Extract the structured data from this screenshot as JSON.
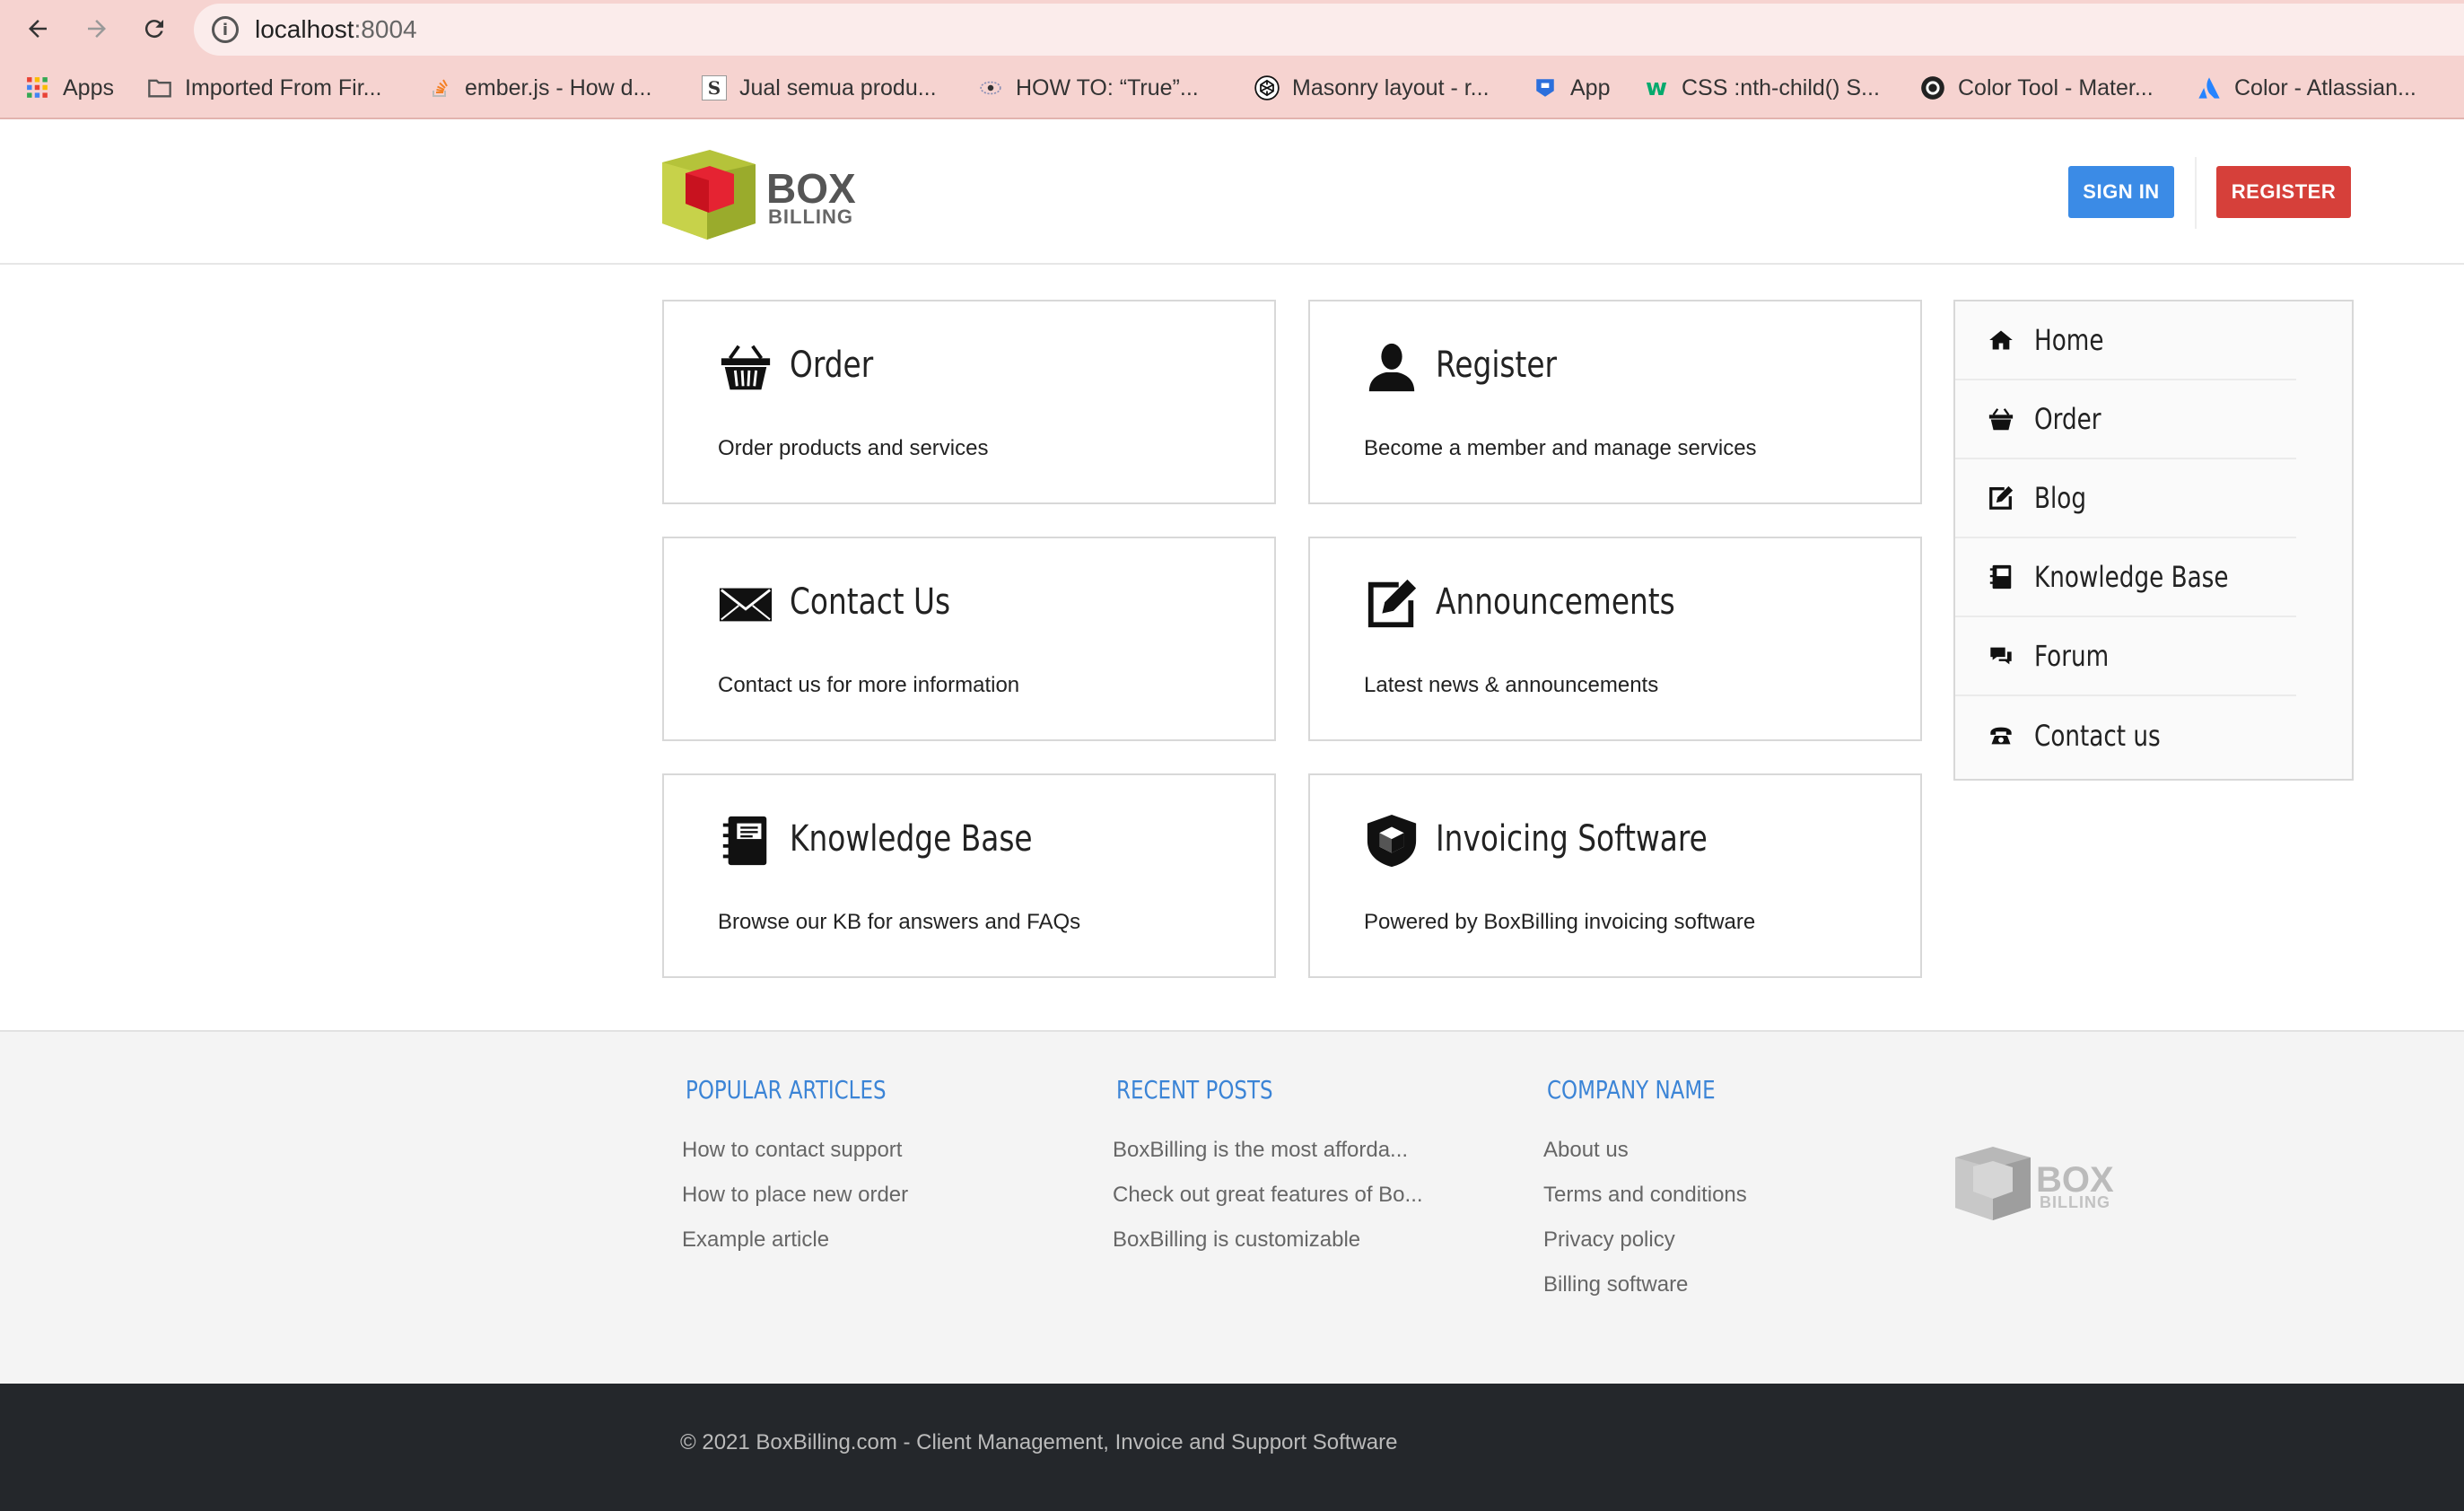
{
  "browser": {
    "url_host": "localhost",
    "url_port": ":8004",
    "bookmarks": [
      {
        "label": "Apps",
        "icon": "apps-grid-icon"
      },
      {
        "label": "Imported From Fir...",
        "icon": "folder-icon"
      },
      {
        "label": "ember.js - How d...",
        "icon": "stackoverflow-icon"
      },
      {
        "label": "Jual semua produ...",
        "icon": "s-icon",
        "glyph": "S"
      },
      {
        "label": "HOW TO: “True”...",
        "icon": "eye-icon"
      },
      {
        "label": "Masonry layout - r...",
        "icon": "codepen-icon"
      },
      {
        "label": "App",
        "icon": "app-icon"
      },
      {
        "label": "CSS :nth-child() S...",
        "icon": "w3schools-icon",
        "glyph": "w"
      },
      {
        "label": "Color Tool - Mater...",
        "icon": "github-icon"
      },
      {
        "label": "Color - Atlassian...",
        "icon": "atlassian-icon"
      }
    ]
  },
  "header": {
    "logo_text_top": "BOX",
    "logo_text_bottom": "BILLING",
    "signin_label": "SIGN IN",
    "register_label": "REGISTER"
  },
  "cards": [
    {
      "title": "Order",
      "desc": "Order products and services",
      "icon": "basket-icon"
    },
    {
      "title": "Register",
      "desc": "Become a member and manage services",
      "icon": "user-icon"
    },
    {
      "title": "Contact Us",
      "desc": "Contact us for more information",
      "icon": "envelope-icon"
    },
    {
      "title": "Announcements",
      "desc": "Latest news & announcements",
      "icon": "edit-icon"
    },
    {
      "title": "Knowledge Base",
      "desc": "Browse our KB for answers and FAQs",
      "icon": "book-icon"
    },
    {
      "title": "Invoicing Software",
      "desc": "Powered by BoxBilling invoicing software",
      "icon": "shield-box-icon"
    }
  ],
  "sidemenu": [
    {
      "label": "Home",
      "icon": "home-icon"
    },
    {
      "label": "Order",
      "icon": "basket-icon"
    },
    {
      "label": "Blog",
      "icon": "edit-icon"
    },
    {
      "label": "Knowledge Base",
      "icon": "book-icon"
    },
    {
      "label": "Forum",
      "icon": "comments-icon"
    },
    {
      "label": "Contact us",
      "icon": "phone-icon"
    }
  ],
  "footer": {
    "popular": {
      "heading": "POPULAR ARTICLES",
      "links": [
        "How to contact support",
        "How to place new order",
        "Example article"
      ]
    },
    "recent": {
      "heading": "RECENT POSTS",
      "links": [
        "BoxBilling is the most afforda...",
        "Check out great features of Bo...",
        "BoxBilling is customizable"
      ]
    },
    "company": {
      "heading": "COMPANY NAME",
      "links": [
        "About us",
        "Terms and conditions",
        "Privacy policy",
        "Billing software"
      ]
    },
    "copyright": "© 2021 BoxBilling.com - Client Management, Invoice and Support Software"
  },
  "colors": {
    "accent_blue": "#3b8be6",
    "register_red": "#d6403a",
    "footer_heading": "#3b84d6",
    "chrome_bar": "#f6d3d0",
    "bottom_bar": "#24272b"
  }
}
